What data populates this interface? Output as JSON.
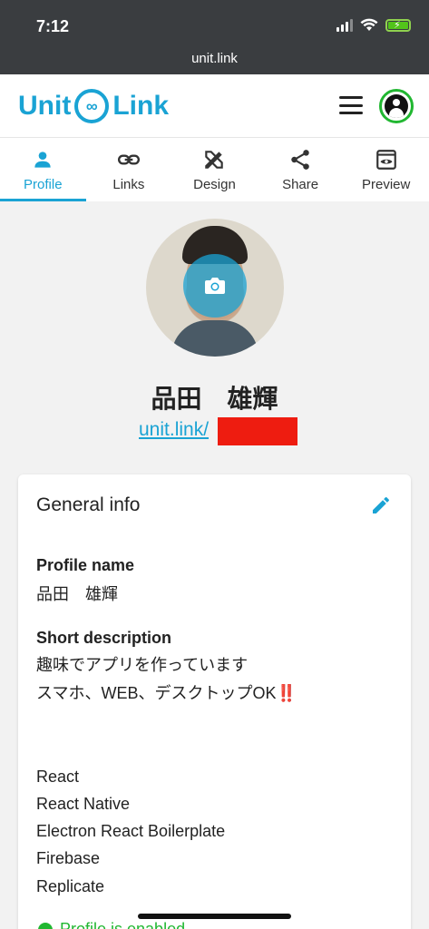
{
  "status_bar": {
    "time": "7:12"
  },
  "browser": {
    "url": "unit.link"
  },
  "header": {
    "logo_left": "Unit",
    "logo_right": "Link"
  },
  "tabs": [
    {
      "label": "Profile",
      "icon": "person-icon",
      "active": true
    },
    {
      "label": "Links",
      "icon": "link-icon",
      "active": false
    },
    {
      "label": "Design",
      "icon": "design-tools-icon",
      "active": false
    },
    {
      "label": "Share",
      "icon": "share-icon",
      "active": false
    },
    {
      "label": "Preview",
      "icon": "preview-icon",
      "active": false
    }
  ],
  "profile": {
    "name": "品田　雄輝",
    "url_prefix": "unit.link/"
  },
  "general_info": {
    "title": "General info",
    "profile_name_label": "Profile name",
    "profile_name_value": "品田　雄輝",
    "short_description_label": "Short description",
    "description_lines": [
      "趣味でアプリを作っています",
      "スマホ、WEB、デスクトップOK‼️",
      "",
      "",
      "React",
      "React Native",
      "Electron React Boilerplate",
      "Firebase",
      "Replicate"
    ],
    "status_text": "Profile is enabled"
  },
  "colors": {
    "accent": "#1aa3d4",
    "status_green": "#21b731",
    "redaction": "#ee1c10"
  }
}
